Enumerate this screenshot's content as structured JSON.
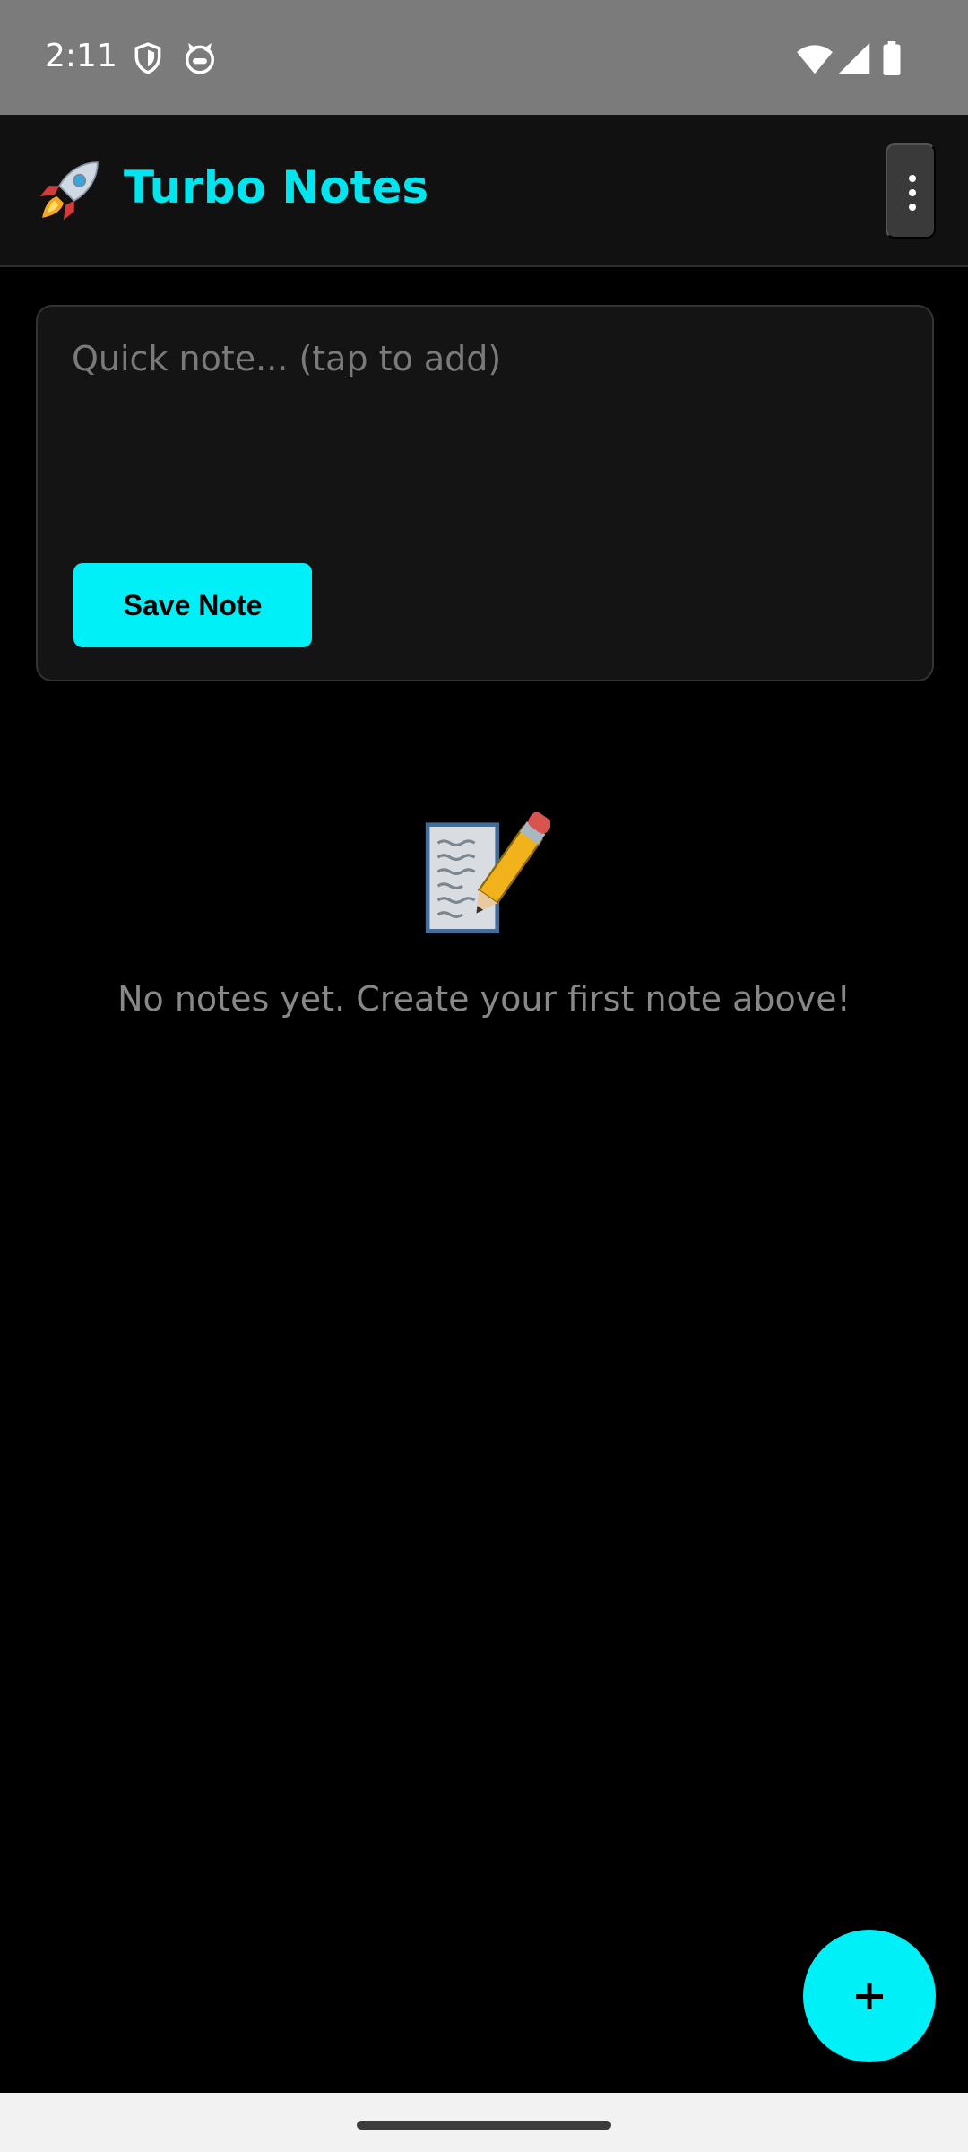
{
  "status_bar": {
    "time": "2:11",
    "icons": [
      "shield-icon",
      "cat-face-icon",
      "wifi-icon",
      "signal-icon",
      "battery-icon"
    ]
  },
  "app_bar": {
    "logo_icon": "rocket-icon",
    "title": "Turbo Notes",
    "menu_icon": "more-vertical-icon"
  },
  "quick_note": {
    "placeholder": "Quick note... (tap to add)",
    "value": "",
    "save_label": "Save Note"
  },
  "empty_state": {
    "icon": "memo-pencil-icon",
    "message": "No notes yet. Create your first note above!"
  },
  "fab": {
    "icon": "plus-icon"
  },
  "colors": {
    "accent": "#00f0f8",
    "title": "#00e5ee",
    "background": "#000000",
    "surface": "#141414"
  }
}
